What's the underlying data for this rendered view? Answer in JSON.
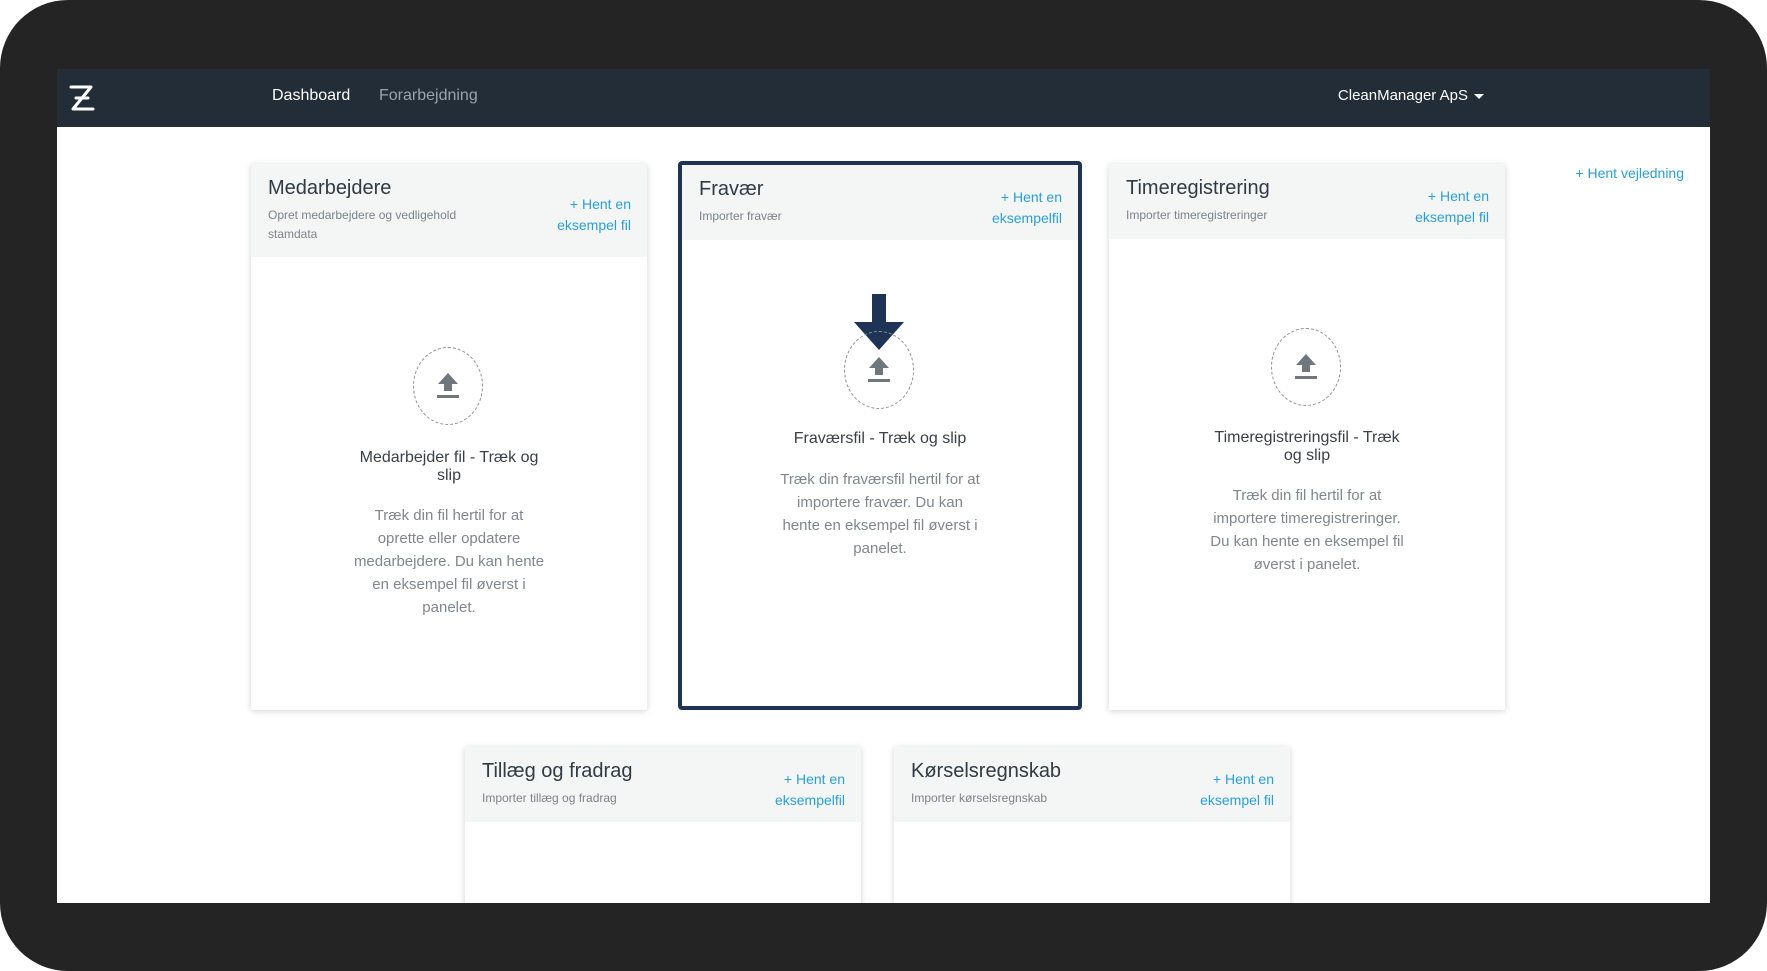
{
  "nav": {
    "links": [
      "Dashboard",
      "Forarbejdning"
    ],
    "user": "CleanManager ApS"
  },
  "guide_link": "+ Hent vejledning",
  "cards": [
    {
      "title": "Medarbejdere",
      "subtitle": "Opret medarbejdere og vedligehold stamdata",
      "link": "+ Hent en eksempel fil",
      "drop_title": "Medarbejder fil - Træk og slip",
      "drop_desc": "Træk din fil hertil for at oprette eller opdatere medarbejdere. Du kan hente en eksempel fil øverst i panelet."
    },
    {
      "title": "Fravær",
      "subtitle": "Importer fravær",
      "link": "+ Hent en eksempelfil",
      "drop_title": "Fraværsfil - Træk og slip",
      "drop_desc": "Træk din fraværsfil hertil for at importere fravær. Du kan hente en eksempel fil øverst i panelet."
    },
    {
      "title": "Timeregistrering",
      "subtitle": "Importer timeregistreringer",
      "link": "+ Hent en eksempel fil",
      "drop_title": "Timeregistreringsfil - Træk og slip",
      "drop_desc": "Træk din fil hertil for at importere timeregistreringer. Du kan hente en eksempel fil øverst i panelet."
    },
    {
      "title": "Tillæg og fradrag",
      "subtitle": "Importer tillæg og fradrag",
      "link": "+ Hent en eksempelfil"
    },
    {
      "title": "Kørselsregnskab",
      "subtitle": "Importer kørselsregnskab",
      "link": "+ Hent en eksempel fil"
    }
  ],
  "colors": {
    "navbar": "#222d37",
    "link": "#2a9fd6",
    "selected_border": "#1e3355",
    "frame": "#242424"
  }
}
